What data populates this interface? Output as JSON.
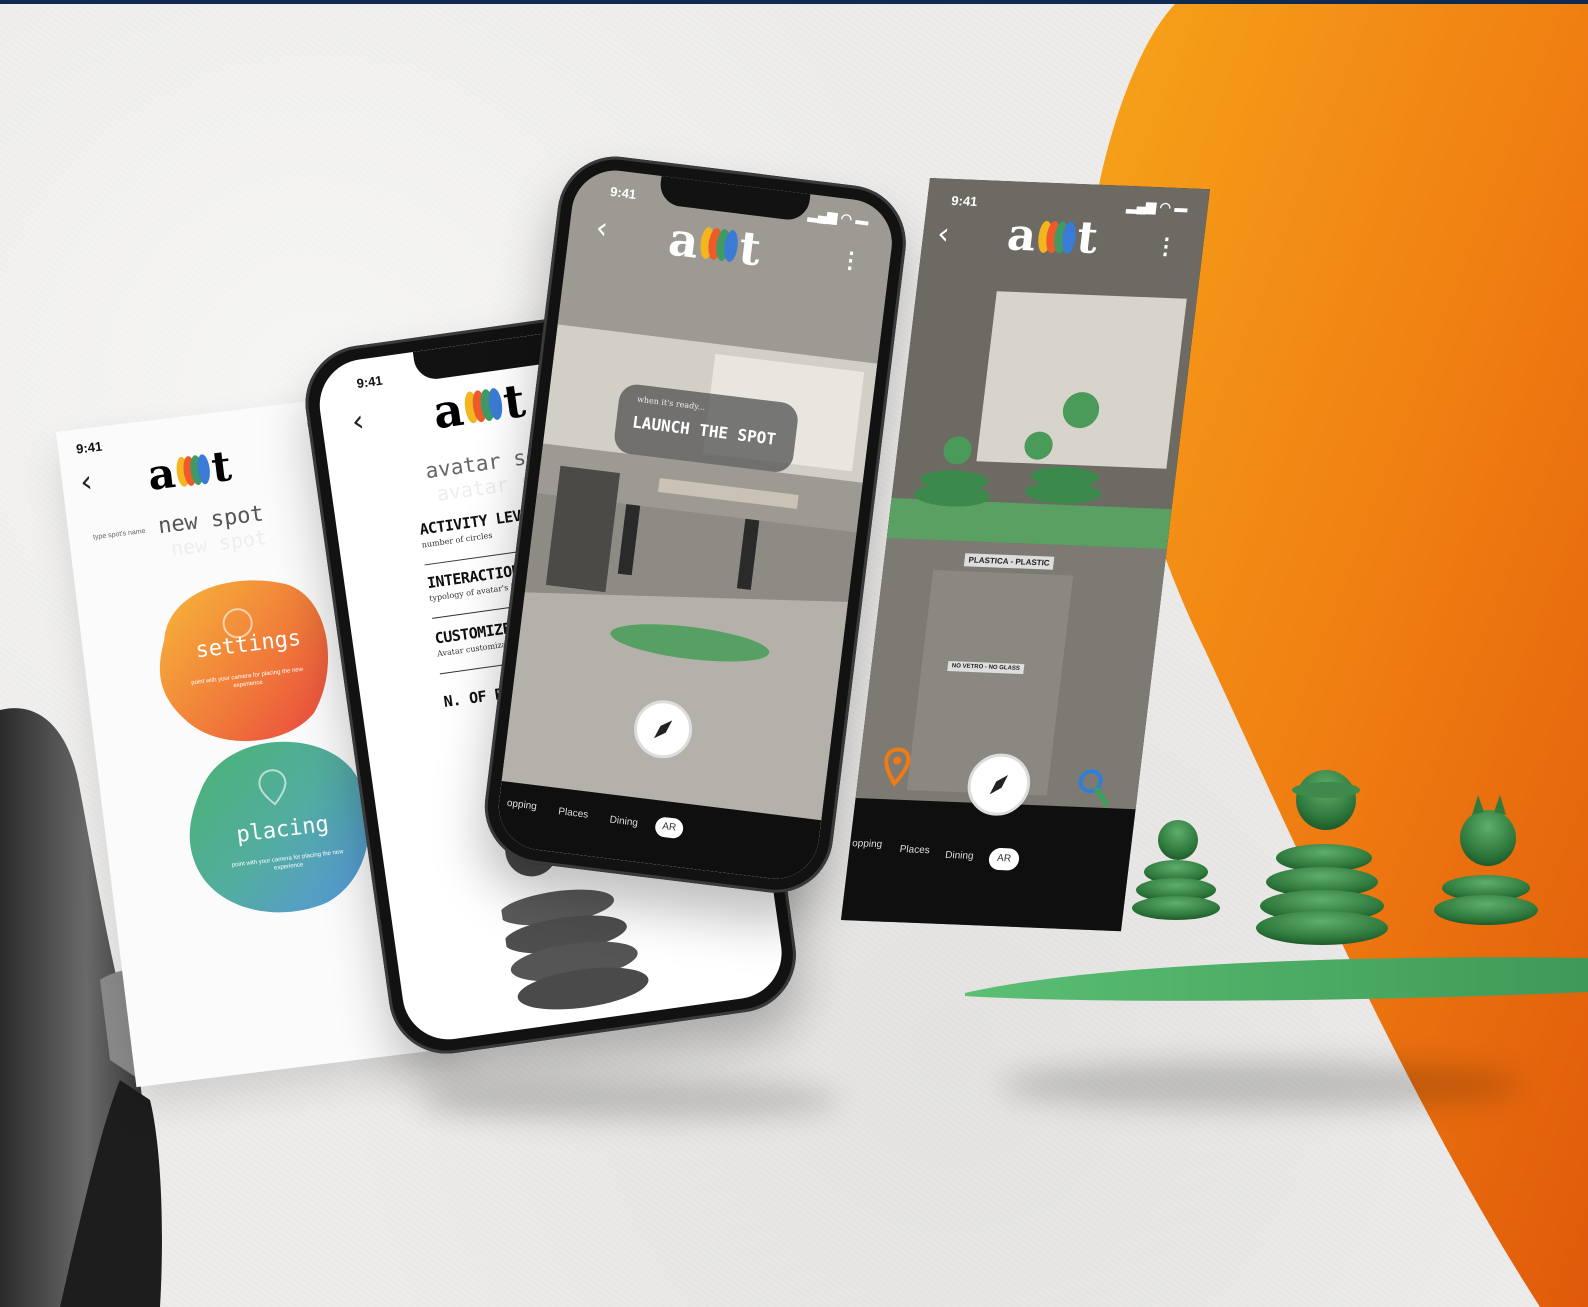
{
  "app": {
    "logo_a": "a",
    "logo_t": "t"
  },
  "status": {
    "time": "9:41"
  },
  "screen1": {
    "name_label": "type spot's name",
    "title": "new spot",
    "ghost_title": "new spot",
    "settings": {
      "label": "settings",
      "desc": "point with your camera for placing the new experience"
    },
    "placing": {
      "label": "placing",
      "desc": "point with your camera for placing the new experience"
    }
  },
  "screen2": {
    "title": "avatar settings",
    "ghost_title": "avatar settings",
    "rows": [
      {
        "title": "ACTIVITY LEVEL",
        "sub": "number of circles"
      },
      {
        "title": "INTERACTIONS",
        "sub": "typology of avatar's interactions"
      },
      {
        "title": "CUSTOMIZE",
        "sub": "Avatar customization"
      },
      {
        "title": "N. OF PARTICIPAN",
        "sub": ""
      }
    ]
  },
  "screen3": {
    "hint": "when it's ready...",
    "launch": "LAUNCH THE SPOT",
    "tabs": [
      "opping",
      "Places",
      "Dining",
      "AR"
    ]
  },
  "screen4": {
    "sign1": "PLASTICA - PLASTIC",
    "sign2": "NO VETRO - NO GLASS",
    "tabs": [
      "opping",
      "Places",
      "Dining",
      "AR"
    ]
  },
  "colors": {
    "accent_orange": "#f07a14",
    "accent_green": "#4aa35a",
    "navy": "#0f2a4e"
  }
}
